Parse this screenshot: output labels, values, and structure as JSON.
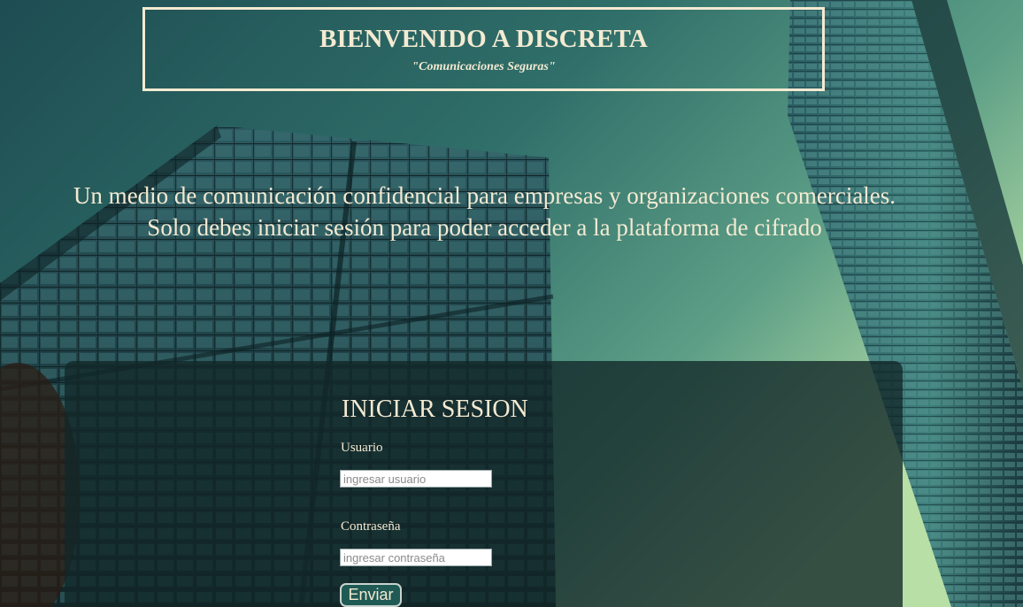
{
  "header": {
    "title": "BIENVENIDO A DISCRETA",
    "subtitle": "\"Comunicaciones Seguras\""
  },
  "intro": {
    "line1": "Un medio de comunicación confidencial para empresas y organizaciones comerciales.",
    "line2": "Solo debes iniciar sesión para poder acceder a la plataforma de cifrado"
  },
  "login": {
    "title": "INICIAR SESION",
    "username_label": "Usuario",
    "username_placeholder": "ingresar usuario",
    "username_value": "",
    "password_label": "Contraseña",
    "password_placeholder": "ingresar contraseña",
    "password_value": "",
    "submit_label": "Enviar"
  },
  "colors": {
    "text": "#f4ead2",
    "sky_top": "#1e4f52",
    "sky_light": "#a8d6a0",
    "panel": "#122628",
    "button": "#1f5a54"
  }
}
